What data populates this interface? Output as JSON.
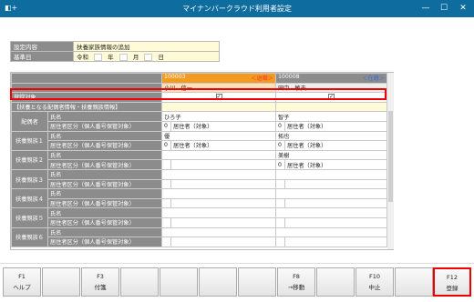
{
  "window": {
    "icon": "◧+",
    "title": "マイナンバークラウド利用者設定",
    "minimize": "—",
    "maximize": "☐",
    "close": "✕"
  },
  "info": {
    "row1_label": "設定内容",
    "row1_value": "扶養家族情報の追加",
    "row2_label": "基準日",
    "era": "令和",
    "year_unit": "年",
    "month_unit": "月",
    "day_unit": "日"
  },
  "grid": {
    "target_label": "登録対象",
    "section_label": "【扶養となる配偶者情報・扶養親族情報】",
    "field_name": "氏名",
    "field_residence": "居住者区分（個人番号保管対象）",
    "employees": [
      {
        "code": "100003",
        "status": "＜退職＞",
        "name": "小川　信一",
        "checked": "✓"
      },
      {
        "code": "100008",
        "status": "＜在籍＞",
        "name": "田中　敏夫",
        "checked": "✓"
      }
    ],
    "groups": [
      {
        "label": "配偶者",
        "emp1_name": "ひろ子",
        "emp1_code": "0",
        "emp1_res": "居住者（対象）",
        "emp2_name": "智子",
        "emp2_code": "0",
        "emp2_res": "居住者（対象）"
      },
      {
        "label": "扶養親族１",
        "emp1_name": "優",
        "emp1_code": "0",
        "emp1_res": "居住者（対象）",
        "emp2_name": "拓也",
        "emp2_code": "0",
        "emp2_res": "居住者（対象）"
      },
      {
        "label": "扶養親族２",
        "emp1_name": "",
        "emp1_code": "",
        "emp1_res": "",
        "emp2_name": "美樹",
        "emp2_code": "0",
        "emp2_res": "居住者（対象）"
      },
      {
        "label": "扶養親族３",
        "emp1_name": "",
        "emp1_code": "",
        "emp1_res": "",
        "emp2_name": "",
        "emp2_code": "",
        "emp2_res": ""
      },
      {
        "label": "扶養親族４",
        "emp1_name": "",
        "emp1_code": "",
        "emp1_res": "",
        "emp2_name": "",
        "emp2_code": "",
        "emp2_res": ""
      },
      {
        "label": "扶養親族５",
        "emp1_name": "",
        "emp1_code": "",
        "emp1_res": "",
        "emp2_name": "",
        "emp2_code": "",
        "emp2_res": ""
      },
      {
        "label": "扶養親族６",
        "emp1_name": "",
        "emp1_code": "",
        "emp1_res": "",
        "emp2_name": "",
        "emp2_code": "",
        "emp2_res": ""
      }
    ]
  },
  "fkeys": {
    "f1_key": "F1",
    "f1_label": "ヘルプ",
    "f3_key": "F3",
    "f3_label": "付箋",
    "f8_key": "F8",
    "f8_label": "→移動",
    "f10_key": "F10",
    "f10_label": "中止",
    "f12_key": "F12",
    "f12_label": "登録"
  }
}
